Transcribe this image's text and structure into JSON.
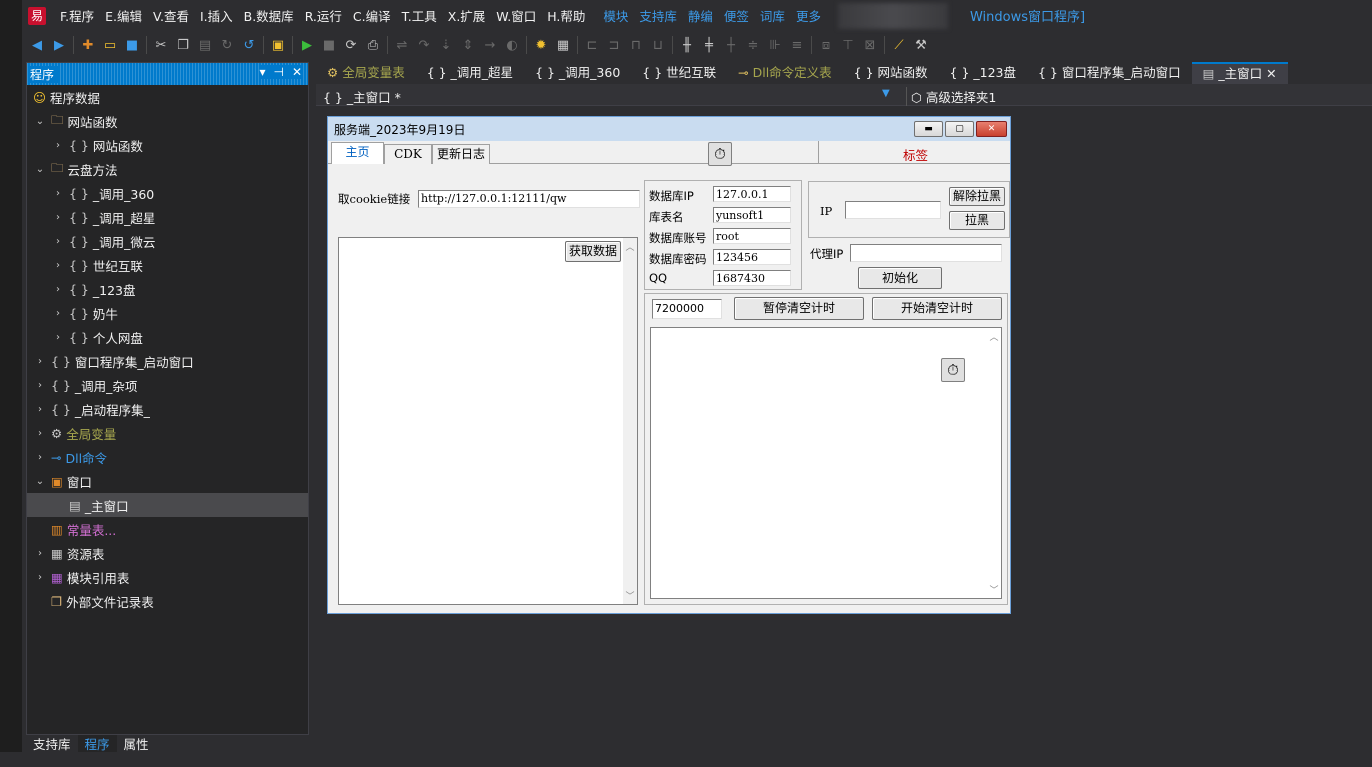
{
  "menubar": {
    "logo": "易",
    "items": [
      "F.程序",
      "E.编辑",
      "V.查看",
      "I.插入",
      "B.数据库",
      "R.运行",
      "C.编译",
      "T.工具",
      "X.扩展",
      "W.窗口",
      "H.帮助"
    ],
    "links": [
      "模块",
      "支持库",
      "静编",
      "便签",
      "词库",
      "更多"
    ],
    "window_title": "Windows窗口程序]"
  },
  "toolbar": {
    "icons": [
      "back-icon",
      "forward-icon",
      "new-file-icon",
      "open-folder-icon",
      "save-icon",
      "cut-icon",
      "copy-icon",
      "paste-icon",
      "redo-icon",
      "undo-icon",
      "insert-icon",
      "run-icon",
      "stop-icon",
      "restart-icon",
      "compile-icon",
      "step-icon",
      "step-over-icon",
      "step-in-icon",
      "step-out-icon",
      "run-to-icon",
      "breakpoint-icon",
      "hint-icon",
      "properties-icon",
      "align-left-icon",
      "align-right-icon",
      "align-top-icon",
      "align-bottom-icon",
      "center-h-icon",
      "center-v-icon",
      "space-h-icon",
      "space-v-icon",
      "equal-width-icon",
      "equal-height-icon",
      "tab-order-icon",
      "same-size-icon",
      "grid-icon",
      "wand-icon",
      "tools-icon"
    ]
  },
  "leftpanel": {
    "title": "程序",
    "ctrls": [
      "▾",
      "⊣",
      "✕"
    ],
    "tree": [
      {
        "label": "程序数据",
        "icon": "smiley-icon",
        "level": 0,
        "arrow": ""
      },
      {
        "label": "网站函数",
        "icon": "folder-icon",
        "level": 1,
        "arrow": "⌄"
      },
      {
        "label": "网站函数",
        "icon": "braces-icon",
        "level": 2,
        "arrow": "›"
      },
      {
        "label": "云盘方法",
        "icon": "folder-icon",
        "level": 1,
        "arrow": "⌄"
      },
      {
        "label": "_调用_360",
        "icon": "braces-icon",
        "level": 2,
        "arrow": "›"
      },
      {
        "label": "_调用_超星",
        "icon": "braces-icon",
        "level": 2,
        "arrow": "›"
      },
      {
        "label": "_调用_微云",
        "icon": "braces-icon",
        "level": 2,
        "arrow": "›"
      },
      {
        "label": "世纪互联",
        "icon": "braces-icon",
        "level": 2,
        "arrow": "›"
      },
      {
        "label": "_123盘",
        "icon": "braces-icon",
        "level": 2,
        "arrow": "›"
      },
      {
        "label": "奶牛",
        "icon": "braces-icon",
        "level": 2,
        "arrow": "›"
      },
      {
        "label": "个人网盘",
        "icon": "braces-icon",
        "level": 2,
        "arrow": "›"
      },
      {
        "label": "窗口程序集_启动窗口",
        "icon": "braces-icon",
        "level": 1,
        "arrow": "›"
      },
      {
        "label": "_调用_杂项",
        "icon": "braces-icon",
        "level": 1,
        "arrow": "›"
      },
      {
        "label": "_启动程序集_",
        "icon": "braces-icon",
        "level": 1,
        "arrow": "›"
      },
      {
        "label": "全局变量",
        "icon": "global-var-icon",
        "level": 1,
        "arrow": "›",
        "color": "olive"
      },
      {
        "label": "Dll命令",
        "icon": "dll-icon",
        "level": 1,
        "arrow": "›",
        "color": "blue"
      },
      {
        "label": "窗口",
        "icon": "window-icon",
        "level": 1,
        "arrow": "⌄"
      },
      {
        "label": "_主窗口",
        "icon": "form-icon",
        "level": 2,
        "arrow": "",
        "selected": true
      },
      {
        "label": "常量表...",
        "icon": "constant-icon",
        "level": 1,
        "arrow": "",
        "color": "pink"
      },
      {
        "label": "资源表",
        "icon": "resource-icon",
        "level": 1,
        "arrow": "›"
      },
      {
        "label": "模块引用表",
        "icon": "module-icon",
        "level": 1,
        "arrow": "›"
      },
      {
        "label": "外部文件记录表",
        "icon": "external-file-icon",
        "level": 1,
        "arrow": ""
      }
    ]
  },
  "bottom_tabs": [
    "支持库",
    "程序",
    "属性"
  ],
  "doc_tabs": [
    {
      "label": "全局变量表",
      "icon": "global-var-icon",
      "color": "olive"
    },
    {
      "label": "{ } _调用_超星"
    },
    {
      "label": "{ } _调用_360"
    },
    {
      "label": "{ } 世纪互联"
    },
    {
      "label": "Dll命令定义表",
      "icon": "dll-icon",
      "color": "olive"
    },
    {
      "label": "{ } 网站函数"
    },
    {
      "label": "{ } _123盘"
    },
    {
      "label": "{ } 窗口程序集_启动窗口"
    },
    {
      "label": "_主窗口",
      "icon": "form-icon",
      "active": true
    }
  ],
  "subbar": {
    "current": "{ } _主窗口 *",
    "advanced": "高级选择夹1"
  },
  "form": {
    "caption": "服务端_2023年9月19日",
    "tabs": [
      "主页",
      "CDK",
      "更新日志"
    ],
    "tab_label": "标签",
    "cookie_label": "取cookie链接",
    "cookie_value": "http://127.0.0.1:12111/qw",
    "fetch_button": "获取数据",
    "db_fields": [
      {
        "label": "数据库IP",
        "value": "127.0.0.1"
      },
      {
        "label": "库表名",
        "value": "yunsoft1"
      },
      {
        "label": "数据库账号",
        "value": "root"
      },
      {
        "label": "数据库密码",
        "value": "123456"
      },
      {
        "label": "QQ",
        "value": "1687430"
      }
    ],
    "ip_label": "IP",
    "ip_value": "",
    "unblock_button": "解除拉黑",
    "block_button": "拉黑",
    "proxy_label": "代理IP",
    "proxy_value": "",
    "init_button": "初始化",
    "interval_value": "7200000",
    "pause_button": "暂停清空计时",
    "start_button": "开始清空计时"
  }
}
